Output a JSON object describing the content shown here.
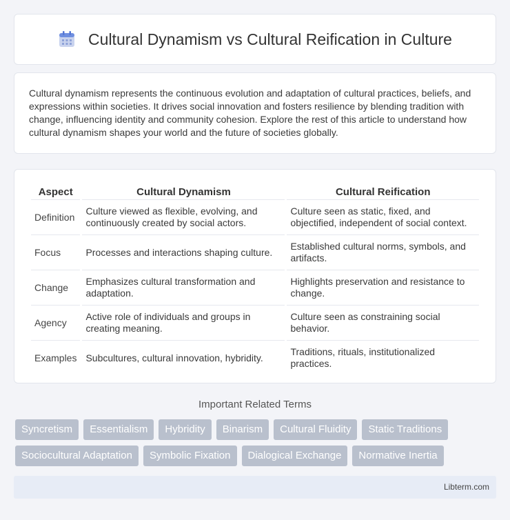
{
  "header": {
    "title": "Cultural Dynamism vs Cultural Reification in Culture",
    "icon": "calendar-icon"
  },
  "intro": {
    "text": "Cultural dynamism represents the continuous evolution and adaptation of cultural practices, beliefs, and expressions within societies. It drives social innovation and fosters resilience by blending tradition with change, influencing identity and community cohesion. Explore the rest of this article to understand how cultural dynamism shapes your world and the future of societies globally."
  },
  "table": {
    "headers": [
      "Aspect",
      "Cultural Dynamism",
      "Cultural Reification"
    ],
    "rows": [
      [
        "Definition",
        "Culture viewed as flexible, evolving, and continuously created by social actors.",
        "Culture seen as static, fixed, and objectified, independent of social context."
      ],
      [
        "Focus",
        "Processes and interactions shaping culture.",
        "Established cultural norms, symbols, and artifacts."
      ],
      [
        "Change",
        "Emphasizes cultural transformation and adaptation.",
        "Highlights preservation and resistance to change."
      ],
      [
        "Agency",
        "Active role of individuals and groups in creating meaning.",
        "Culture seen as constraining social behavior."
      ],
      [
        "Examples",
        "Subcultures, cultural innovation, hybridity.",
        "Traditions, rituals, institutionalized practices."
      ]
    ]
  },
  "related": {
    "heading": "Important Related Terms",
    "tags": [
      "Syncretism",
      "Essentialism",
      "Hybridity",
      "Binarism",
      "Cultural Fluidity",
      "Static Traditions",
      "Sociocultural Adaptation",
      "Symbolic Fixation",
      "Dialogical Exchange",
      "Normative Inertia"
    ]
  },
  "footer": {
    "text": "Libterm.com"
  }
}
